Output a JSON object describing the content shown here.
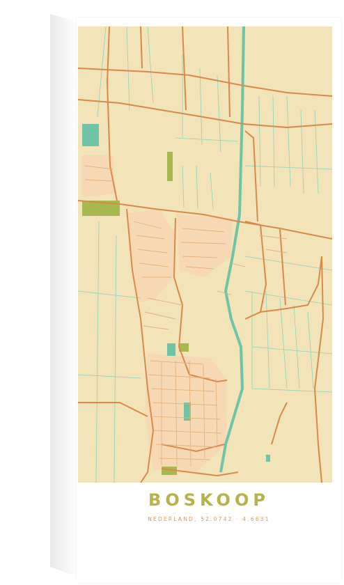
{
  "map": {
    "colors": {
      "land": "#f2e3b9",
      "road": "#d9894a",
      "minor_road": "#e3b07a",
      "water": "#6fc4a8",
      "ditch": "#8fd2bb",
      "park": "#a7b94e",
      "urban": "#f6d9b4"
    }
  },
  "poster": {
    "title": "BOSKOOP",
    "subtitle": "NEDERLAND, 52.0742 · 4.6631"
  }
}
